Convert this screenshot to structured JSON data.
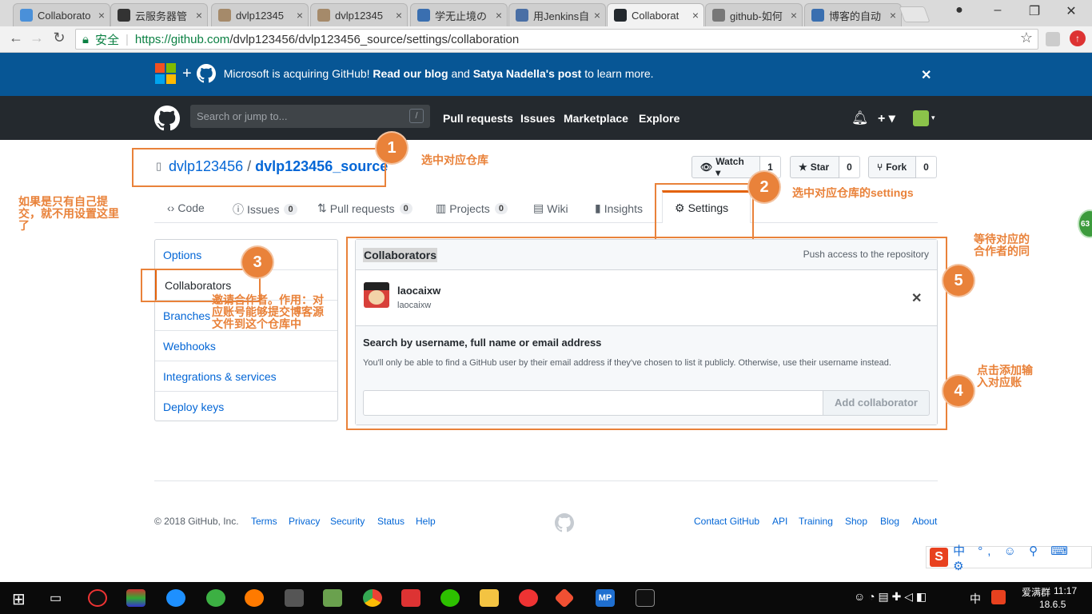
{
  "browser": {
    "tabs": [
      {
        "title": "Collaborato",
        "color": "#4a90d9",
        "active": false
      },
      {
        "title": "云服务器管",
        "color": "#333333",
        "active": false
      },
      {
        "title": "dvlp12345",
        "color": "#a58a6a",
        "active": false
      },
      {
        "title": "dvlp12345",
        "color": "#a58a6a",
        "active": false
      },
      {
        "title": "学无止境の",
        "color": "#3a6fb0",
        "active": false
      },
      {
        "title": "用Jenkins自",
        "color": "#4a6fa5",
        "active": false
      },
      {
        "title": "Collaborat",
        "color": "#24292e",
        "active": true
      },
      {
        "title": "github-如何",
        "color": "#777777",
        "active": false
      },
      {
        "title": "博客的自动",
        "color": "#3a6fb0",
        "active": false
      }
    ],
    "secure_label": "安全",
    "url_host": "https://github.com",
    "url_path": "/dvlp123456/dvlp123456_source/settings/collaboration"
  },
  "banner": {
    "text_a": "Microsoft is acquiring GitHub!",
    "link_a": "Read our blog",
    "text_b": "and",
    "link_b": "Satya Nadella's post",
    "text_c": "to learn more.",
    "close": "✕"
  },
  "header": {
    "search_placeholder": "Search or jump to...",
    "slash": "/",
    "nav": [
      "Pull requests",
      "Issues",
      "Marketplace",
      "Explore"
    ],
    "plus": "+ ▾"
  },
  "repo": {
    "owner": "dvlp123456",
    "divider": "/",
    "name": "dvlp123456_source",
    "watch_label": "Watch ▾",
    "watch_count": "1",
    "star_label": "Star",
    "star_count": "0",
    "fork_label": "Fork",
    "fork_count": "0",
    "tabs": [
      {
        "label": "Code",
        "count": ""
      },
      {
        "label": "Issues",
        "count": "0"
      },
      {
        "label": "Pull requests",
        "count": "0"
      },
      {
        "label": "Projects",
        "count": "0"
      },
      {
        "label": "Wiki",
        "count": ""
      },
      {
        "label": "Insights",
        "count": ""
      },
      {
        "label": "Settings",
        "count": ""
      }
    ]
  },
  "side_menu": [
    "Options",
    "Collaborators",
    "Branches",
    "Webhooks",
    "Integrations & services",
    "Deploy keys"
  ],
  "collab": {
    "title": "Collaborators",
    "subtitle": "Push access to the repository",
    "user_name": "laocaixw",
    "user_login": "laocaixw",
    "remove": "✕",
    "search_label": "Search by username, full name or email address",
    "search_help": "You'll only be able to find a GitHub user by their email address if they've chosen to list it publicly. Otherwise, use their username instead.",
    "add_button": "Add collaborator"
  },
  "annotations": {
    "a1_num": "1",
    "a1_text": "选中对应仓库",
    "a2_num": "2",
    "a2_text": "选中对应仓库的settings",
    "a3_num": "3",
    "a3_text": "邀请合作者。作用：对应账号能够提交博客源文件到这个仓库中",
    "a4_num": "4",
    "a4_text": "点击添加输入对应账",
    "a5_num": "5",
    "a5_text": "等待对应的合作者的同",
    "left_note": "如果是只有自己提交，就不用设置这里了"
  },
  "footer": {
    "copyright": "© 2018 GitHub, Inc.",
    "left_links": [
      "Terms",
      "Privacy",
      "Security",
      "Status",
      "Help"
    ],
    "right_links": [
      "Contact GitHub",
      "API",
      "Training",
      "Shop",
      "Blog",
      "About"
    ]
  },
  "ime": {
    "label": "中 °, ☺ ⚲ ⌨ ⚙"
  },
  "taskbar": {
    "user": "爱满群",
    "time": "11:17",
    "date": "18.6.5",
    "lang": "中"
  },
  "side_badge": "63"
}
